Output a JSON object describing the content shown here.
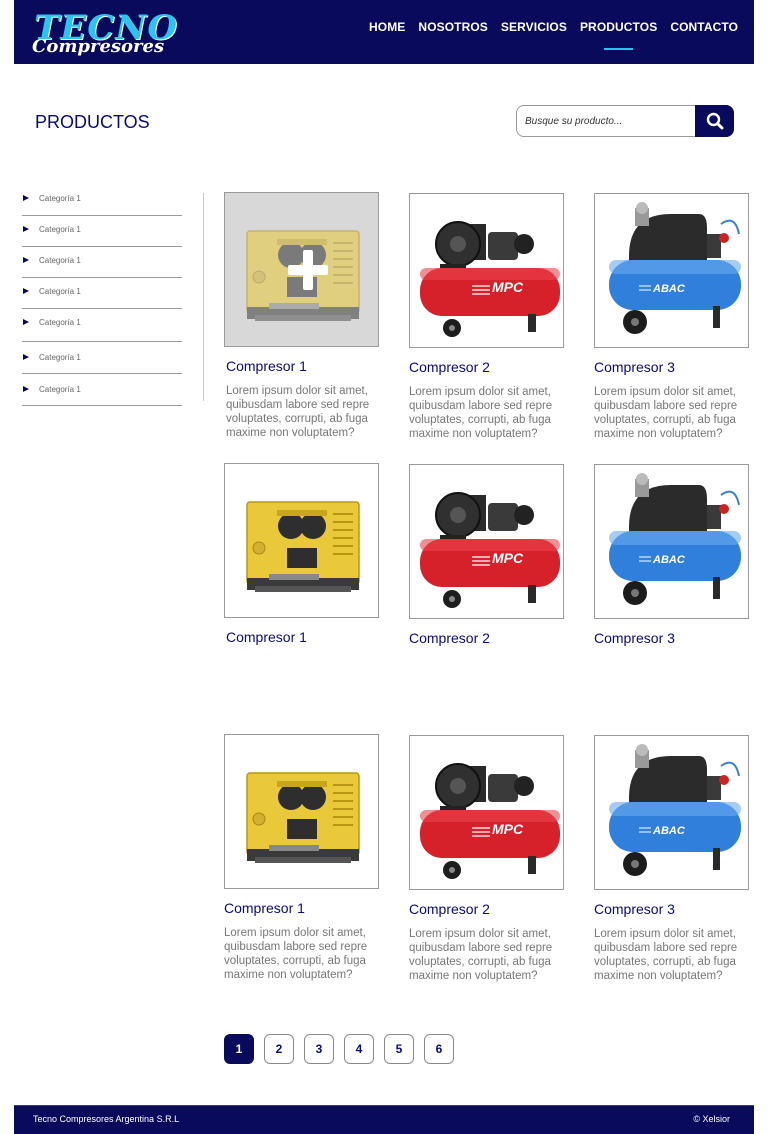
{
  "header": {
    "logo_line1": "TECNO",
    "logo_line2": "Compresores",
    "nav": [
      "HOME",
      "NOSOTROS",
      "SERVICIOS",
      "PRODUCTOS",
      "CONTACTO"
    ],
    "active_nav": "PRODUCTOS",
    "background": "#0a0a5c",
    "accent": "#29c4f0"
  },
  "page_title": "PRODUCTOS",
  "search": {
    "placeholder": "Busque su producto...",
    "button_icon": "search-icon"
  },
  "sidebar": {
    "categories": [
      "Categoría 1",
      "Categoría 1",
      "Categoría 1",
      "Categoría 1",
      "Categoría 1",
      "Categoría 1",
      "Categoría 1"
    ]
  },
  "products": [
    {
      "name": "Compresor 1",
      "desc": "Lorem ipsum dolor sit amet, quibusdam labore sed repre voluptates, corrupti, ab fuga maxime non voluptatem?",
      "image": "yellow-generator",
      "hover": true
    },
    {
      "name": "Compresor 2",
      "desc": "Lorem ipsum dolor sit amet, quibusdam labore sed repre voluptates, corrupti, ab fuga maxime non voluptatem?",
      "image": "red-compressor"
    },
    {
      "name": "Compresor 3",
      "desc": "Lorem ipsum dolor sit amet, quibusdam labore sed repre voluptates, corrupti, ab fuga maxime non voluptatem?",
      "image": "blue-compressor"
    },
    {
      "name": "Compresor 1",
      "desc": "",
      "image": "yellow-generator"
    },
    {
      "name": "Compresor 2",
      "desc": "",
      "image": "red-compressor"
    },
    {
      "name": "Compresor 3",
      "desc": "",
      "image": "blue-compressor"
    },
    {
      "name": "Compresor 1",
      "desc": "Lorem ipsum dolor sit amet, quibusdam labore sed repre voluptates, corrupti, ab fuga maxime non voluptatem?",
      "image": "yellow-generator"
    },
    {
      "name": "Compresor 2",
      "desc": "Lorem ipsum dolor sit amet, quibusdam labore sed repre voluptates, corrupti, ab fuga maxime non voluptatem?",
      "image": "red-compressor"
    },
    {
      "name": "Compresor 3",
      "desc": "Lorem ipsum dolor sit amet, quibusdam labore sed repre voluptates, corrupti, ab fuga maxime non voluptatem?",
      "image": "blue-compressor"
    }
  ],
  "pagination": {
    "pages": [
      "1",
      "2",
      "3",
      "4",
      "5",
      "6"
    ],
    "current": "1"
  },
  "footer": {
    "left": "Tecno Compresores Argentina S.R.L",
    "right": "© Xelsior"
  }
}
